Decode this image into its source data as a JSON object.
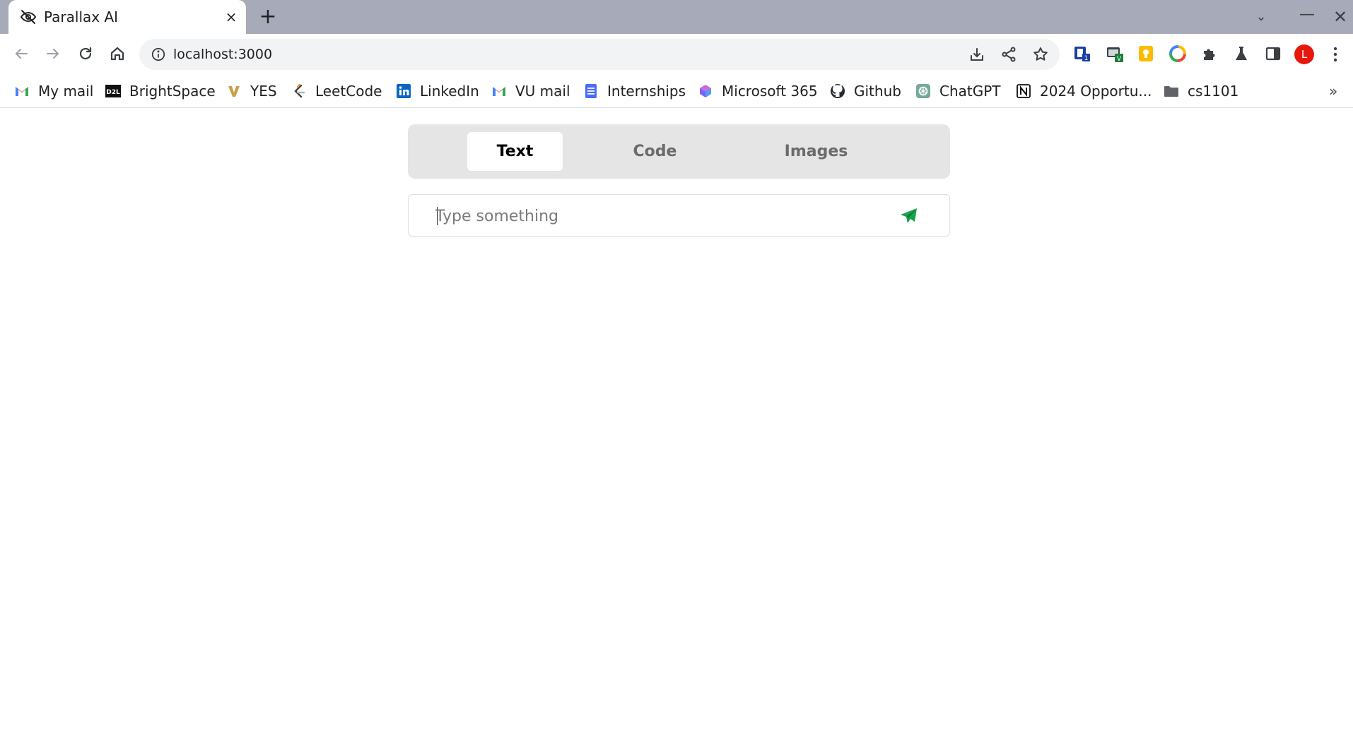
{
  "browser": {
    "tab_title": "Parallax AI",
    "tab_close": "×",
    "new_tab": "+",
    "url": "localhost:3000",
    "profile_initial": "L",
    "bookmarks_more": "»",
    "window_controls": {
      "tab_search": "⌄",
      "minimize": "—",
      "close": "✕"
    }
  },
  "bookmarks": [
    {
      "label": "My mail",
      "icon": "gmail-icon"
    },
    {
      "label": "BrightSpace",
      "icon": "d2l-icon"
    },
    {
      "label": "YES",
      "icon": "vanderbilt-icon"
    },
    {
      "label": "LeetCode",
      "icon": "leetcode-icon"
    },
    {
      "label": "LinkedIn",
      "icon": "linkedin-icon"
    },
    {
      "label": "VU mail",
      "icon": "gmail-icon"
    },
    {
      "label": "Internships",
      "icon": "docs-icon"
    },
    {
      "label": "Microsoft 365",
      "icon": "microsoft365-icon"
    },
    {
      "label": "Github",
      "icon": "github-icon"
    },
    {
      "label": "ChatGPT",
      "icon": "chatgpt-icon"
    },
    {
      "label": "2024 Opportu...",
      "icon": "notion-icon"
    },
    {
      "label": "cs1101",
      "icon": "folder-icon"
    }
  ],
  "app": {
    "modes": [
      {
        "label": "Text",
        "active": true
      },
      {
        "label": "Code",
        "active": false
      },
      {
        "label": "Images",
        "active": false
      }
    ],
    "prompt": {
      "placeholder": "Type something",
      "value": ""
    },
    "colors": {
      "accent": "#16a34a",
      "switch_bg": "#e5e5e5"
    }
  }
}
